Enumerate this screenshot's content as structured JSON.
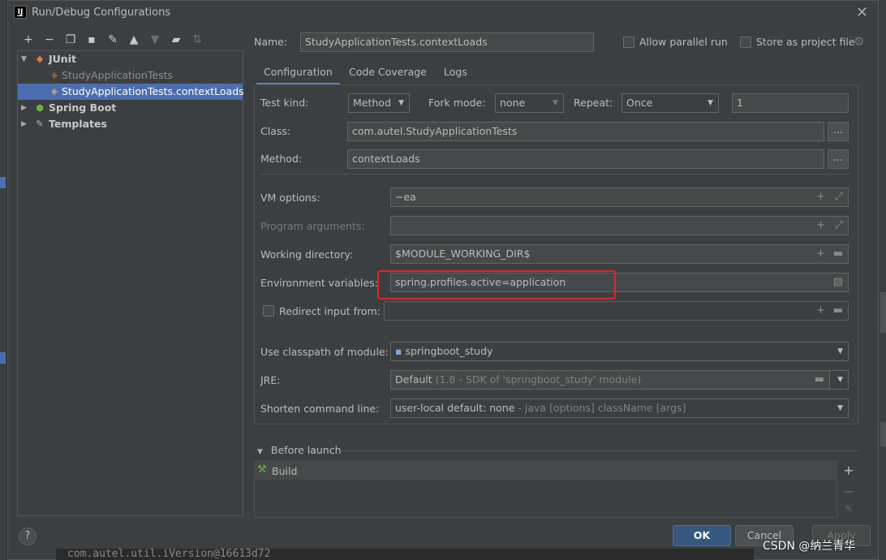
{
  "window": {
    "title": "Run/Debug Configurations",
    "app_icon_text": "IJ"
  },
  "toolbar": {
    "icons": [
      "add-icon",
      "remove-icon",
      "copy-icon",
      "save-icon",
      "wrench-icon",
      "move-up-icon",
      "move-down-icon",
      "new-folder-icon",
      "sort-icon"
    ]
  },
  "tree": {
    "items": [
      {
        "label": "JUnit",
        "bold": true,
        "expanded": true
      },
      {
        "label": "StudyApplicationTests"
      },
      {
        "label": "StudyApplicationTests.contextLoads",
        "selected": true
      },
      {
        "label": "Spring Boot",
        "bold": true,
        "expanded": false
      },
      {
        "label": "Templates",
        "bold": true,
        "expanded": false
      }
    ]
  },
  "header": {
    "name_label": "Name:",
    "name_value": "StudyApplicationTests.contextLoads",
    "parallel_label": "Allow parallel run",
    "store_label": "Store as project file"
  },
  "tabs": [
    {
      "label": "Configuration",
      "active": true
    },
    {
      "label": "Code Coverage"
    },
    {
      "label": "Logs"
    }
  ],
  "config": {
    "test_kind_label": "Test kind:",
    "test_kind_value": "Method",
    "fork_mode_label": "Fork mode:",
    "fork_mode_value": "none",
    "repeat_label": "Repeat:",
    "repeat_value": "Once",
    "repeat_count": "1",
    "class_label": "Class:",
    "class_value": "com.autel.StudyApplicationTests",
    "method_label": "Method:",
    "method_value": "contextLoads",
    "vm_label": "VM options:",
    "vm_value": "−ea",
    "prog_args_label": "Program arguments:",
    "prog_args_value": "",
    "workdir_label": "Working directory:",
    "workdir_value": "$MODULE_WORKING_DIR$",
    "env_label": "Environment variables:",
    "env_value": "spring.profiles.active=application",
    "redirect_label": "Redirect input from:",
    "redirect_value": "",
    "classpath_label": "Use classpath of module:",
    "classpath_value": "springboot_study",
    "jre_label": "JRE:",
    "jre_value": "Default",
    "jre_hint": "(1.8 - SDK of 'springboot_study' module)",
    "shorten_label": "Shorten command line:",
    "shorten_value": "user-local default: none",
    "shorten_hint": "- java [options] className [args]"
  },
  "before_launch": {
    "title": "Before launch",
    "items": [
      {
        "label": "Build"
      }
    ]
  },
  "buttons": {
    "ok": "OK",
    "cancel": "Cancel",
    "apply": "Apply"
  },
  "watermark": "CSDN @纳兰青华",
  "bottom_code": "com.autel.util.iVersion@16613d72",
  "colors": {
    "selection": "#4b6eaf",
    "highlight_box": "#e0262a",
    "ok_button": "#365880"
  }
}
